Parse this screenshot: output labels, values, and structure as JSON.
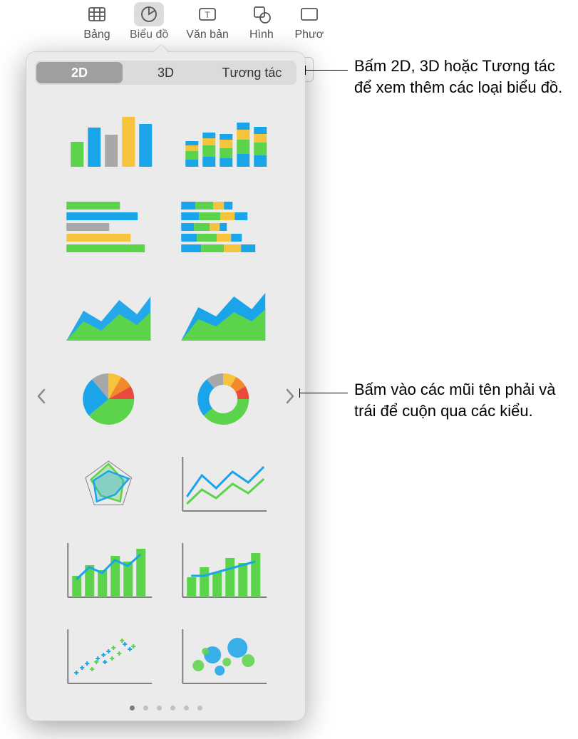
{
  "toolbar": {
    "items": [
      {
        "label": "Bảng",
        "icon": "table-icon"
      },
      {
        "label": "Biểu đồ",
        "icon": "chart-icon",
        "active": true
      },
      {
        "label": "Văn bản",
        "icon": "text-icon"
      },
      {
        "label": "Hình",
        "icon": "shape-icon"
      },
      {
        "label": "Phươ",
        "icon": "media-icon"
      }
    ]
  },
  "segmented": {
    "options": [
      "2D",
      "3D",
      "Tương tác"
    ],
    "active_index": 0
  },
  "pager": {
    "count": 6,
    "active": 0
  },
  "callouts": {
    "top": "Bấm 2D, 3D hoặc Tương tác để xem thêm các loại biểu đồ.",
    "mid": "Bấm vào các mũi tên phải và trái để cuộn qua các kiểu."
  },
  "colors": {
    "green": "#5bd34b",
    "blue": "#1aa4ea",
    "gray": "#a8a8a8",
    "yellow": "#f6c33c",
    "orange": "#f08a2c",
    "red": "#ea4a3b",
    "axis": "#808080"
  },
  "chart_thumbs": [
    {
      "name": "column-chart",
      "type": "column"
    },
    {
      "name": "stacked-column-chart",
      "type": "stacked-column"
    },
    {
      "name": "bar-chart",
      "type": "bar"
    },
    {
      "name": "stacked-bar-chart",
      "type": "stacked-bar"
    },
    {
      "name": "area-chart",
      "type": "area"
    },
    {
      "name": "stacked-area-chart",
      "type": "stacked-area"
    },
    {
      "name": "pie-chart",
      "type": "pie"
    },
    {
      "name": "donut-chart",
      "type": "donut"
    },
    {
      "name": "radar-chart",
      "type": "radar"
    },
    {
      "name": "line-chart",
      "type": "line"
    },
    {
      "name": "combo-chart-1",
      "type": "combo1"
    },
    {
      "name": "combo-chart-2",
      "type": "combo2"
    },
    {
      "name": "scatter-chart",
      "type": "scatter"
    },
    {
      "name": "bubble-chart",
      "type": "bubble"
    }
  ]
}
